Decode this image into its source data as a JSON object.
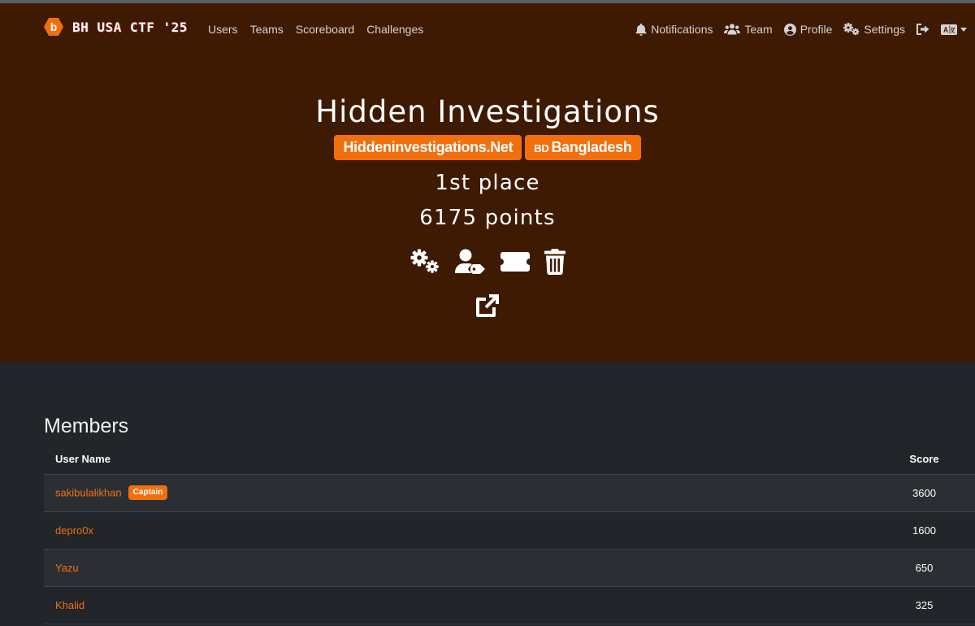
{
  "navbar": {
    "brand": "BH USA CTF '25",
    "brand_logo_letter": "b",
    "links": [
      "Users",
      "Teams",
      "Scoreboard",
      "Challenges"
    ],
    "right": {
      "notifications": "Notifications",
      "team": "Team",
      "profile": "Profile",
      "settings": "Settings"
    }
  },
  "team": {
    "name": "Hidden Investigations",
    "website": "Hiddeninvestigations.Net",
    "country_code": "BD",
    "country": "Bangladesh",
    "place": "1st place",
    "points": "6175 points"
  },
  "icons": {
    "actions": [
      "gears-icon",
      "user-tag-icon",
      "ticket-icon",
      "trash-icon"
    ],
    "share": "external-link-icon"
  },
  "members": {
    "title": "Members",
    "columns": {
      "name": "User Name",
      "score": "Score"
    },
    "captain_label": "Captain",
    "rows": [
      {
        "name": "sakibulalikhan",
        "score": "3600",
        "captain": true
      },
      {
        "name": "depro0x",
        "score": "1600",
        "captain": false
      },
      {
        "name": "Yazu",
        "score": "650",
        "captain": false
      },
      {
        "name": "Khalid",
        "score": "325",
        "captain": false
      }
    ]
  },
  "colors": {
    "accent": "#f26f0e",
    "hero_bg": "#3e1a02",
    "page_bg": "#22252a"
  }
}
